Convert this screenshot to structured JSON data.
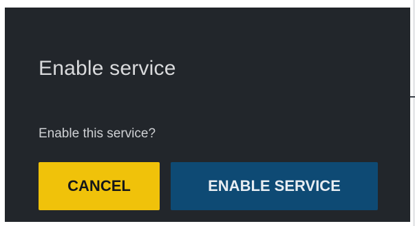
{
  "dialog": {
    "title": "Enable service",
    "message": "Enable this service?",
    "cancel_label": "CANCEL",
    "confirm_label": "ENABLE SERVICE"
  },
  "colors": {
    "dialog_background": "#22262b",
    "cancel_button": "#f0c20a",
    "confirm_button": "#0e4a74",
    "title_text": "#d9dadc"
  }
}
